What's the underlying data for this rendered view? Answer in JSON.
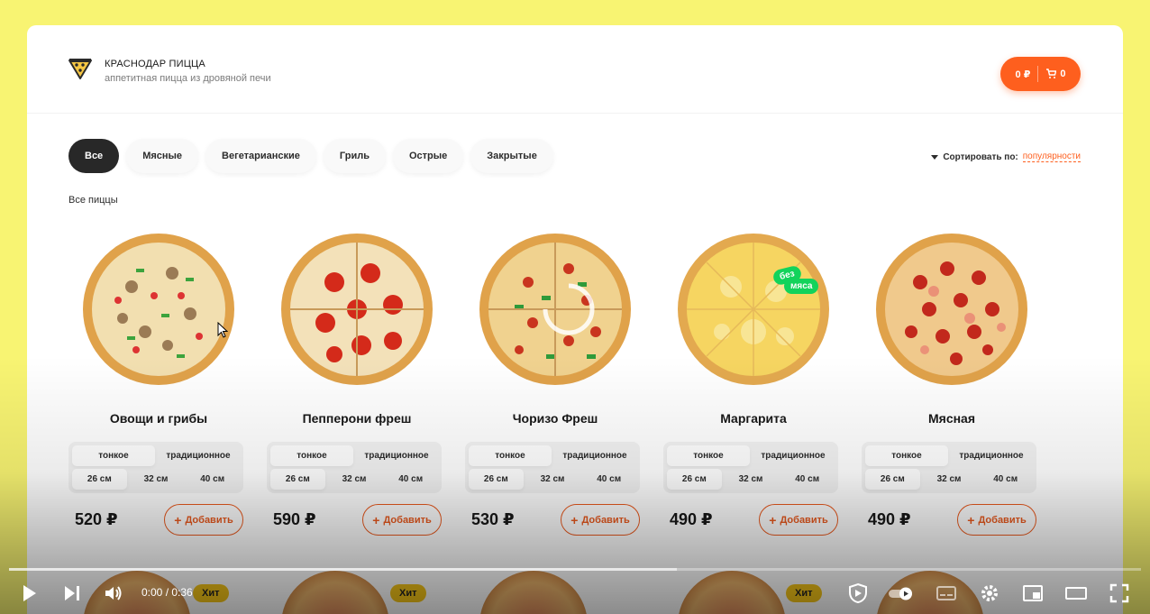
{
  "brand": {
    "title": "КРАСНОДАР ПИЦЦА",
    "subtitle": "аппетитная пицца из дровяной печи",
    "icon": "pizza-slice-icon"
  },
  "cart": {
    "total": "0 ₽",
    "count": "0",
    "icon": "cart-icon",
    "color": "#fe5f1e"
  },
  "categories": [
    "Все",
    "Мясные",
    "Вегетарианские",
    "Гриль",
    "Острые",
    "Закрытые"
  ],
  "active_category": "Все",
  "sort": {
    "label": "Сортировать по:",
    "value": "популярности"
  },
  "section_title": "Все пиццы",
  "pizzas": [
    {
      "name": "Овощи и грибы",
      "price": "520 ₽",
      "types": [
        "тонкое",
        "традиционное"
      ],
      "sizes": [
        "26 см",
        "32 см",
        "40 см"
      ],
      "add": "Добавить"
    },
    {
      "name": "Пепперони фреш",
      "price": "590 ₽",
      "types": [
        "тонкое",
        "традиционное"
      ],
      "sizes": [
        "26 см",
        "32 см",
        "40 см"
      ],
      "add": "Добавить"
    },
    {
      "name": "Чоризо Фреш",
      "price": "530 ₽",
      "types": [
        "тонкое",
        "традиционное"
      ],
      "sizes": [
        "26 см",
        "32 см",
        "40 см"
      ],
      "add": "Добавить"
    },
    {
      "name": "Маргарита",
      "price": "490 ₽",
      "types": [
        "тонкое",
        "традиционное"
      ],
      "sizes": [
        "26 см",
        "32 см",
        "40 см"
      ],
      "add": "Добавить",
      "badge": [
        "без",
        "мяса"
      ]
    },
    {
      "name": "Мясная",
      "price": "490 ₽",
      "types": [
        "тонкое",
        "традиционное"
      ],
      "sizes": [
        "26 см",
        "32 см",
        "40 см"
      ],
      "add": "Добавить"
    }
  ],
  "hit_label": "Хит",
  "player": {
    "time": "0:00 / 0:36",
    "progress": 0.59
  }
}
